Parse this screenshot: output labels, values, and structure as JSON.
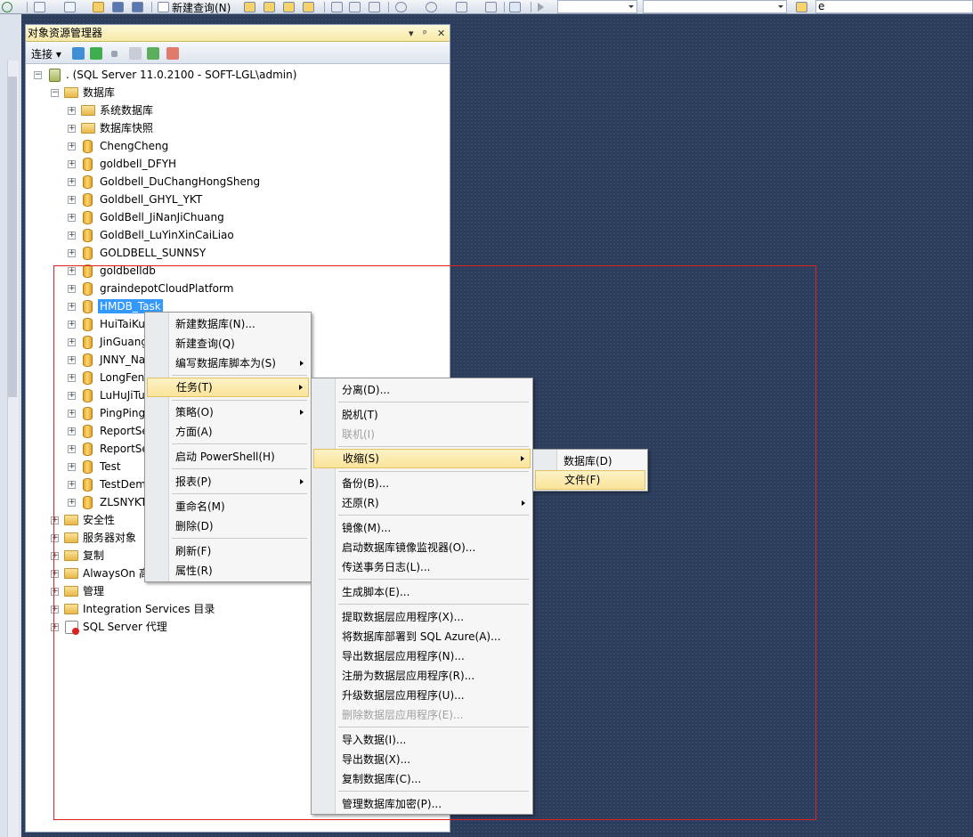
{
  "toolbar": {
    "new_query_label": "新建查询(N)",
    "search_value": "e"
  },
  "explorer": {
    "title": "对象资源管理器",
    "title_controls": [
      "▾",
      "ᵖ",
      "✕"
    ],
    "connect_label": "连接 ▾",
    "server_node": ". (SQL Server 11.0.2100 - SOFT-LGL\\admin)",
    "databases_node": "数据库",
    "system_db": "系统数据库",
    "snapshots": "数据库快照",
    "databases": [
      "ChengCheng",
      "goldbell_DFYH",
      "Goldbell_DuChangHongSheng",
      "Goldbell_GHYL_YKT",
      "GoldBell_JiNanJiChuang",
      "GoldBell_LuYinXinCaiLiao",
      "GOLDBELL_SUNNSY",
      "goldbelldb",
      "graindepotCloudPlatform",
      "HMDB_Task",
      "HuiTaiKu",
      "JinGuang",
      "JNNY_Na",
      "LongFen",
      "LuHuJiTu",
      "PingPing",
      "ReportSe",
      "ReportSe",
      "Test",
      "TestDem",
      "ZLSNYKT"
    ],
    "other_nodes": [
      "安全性",
      "服务器对象",
      "复制",
      "AlwaysOn 高",
      "管理",
      "Integration Services 目录",
      "SQL Server 代理"
    ]
  },
  "menu1": {
    "items": [
      "新建数据库(N)...",
      "新建查询(Q)",
      "编写数据库脚本为(S)",
      "任务(T)",
      "策略(O)",
      "方面(A)",
      "启动 PowerShell(H)",
      "报表(P)",
      "重命名(M)",
      "删除(D)",
      "刷新(F)",
      "属性(R)"
    ]
  },
  "menu2": {
    "items": [
      "分离(D)...",
      "脱机(T)",
      "联机(I)",
      "收缩(S)",
      "备份(B)...",
      "还原(R)",
      "镜像(M)...",
      "启动数据库镜像监视器(O)...",
      "传送事务日志(L)...",
      "生成脚本(E)...",
      "提取数据层应用程序(X)...",
      "将数据库部署到 SQL Azure(A)...",
      "导出数据层应用程序(N)...",
      "注册为数据层应用程序(R)...",
      "升级数据层应用程序(U)...",
      "删除数据层应用程序(E)...",
      "导入数据(I)...",
      "导出数据(X)...",
      "复制数据库(C)...",
      "管理数据库加密(P)..."
    ]
  },
  "menu3": {
    "items": [
      "数据库(D)",
      "文件(F)"
    ]
  }
}
